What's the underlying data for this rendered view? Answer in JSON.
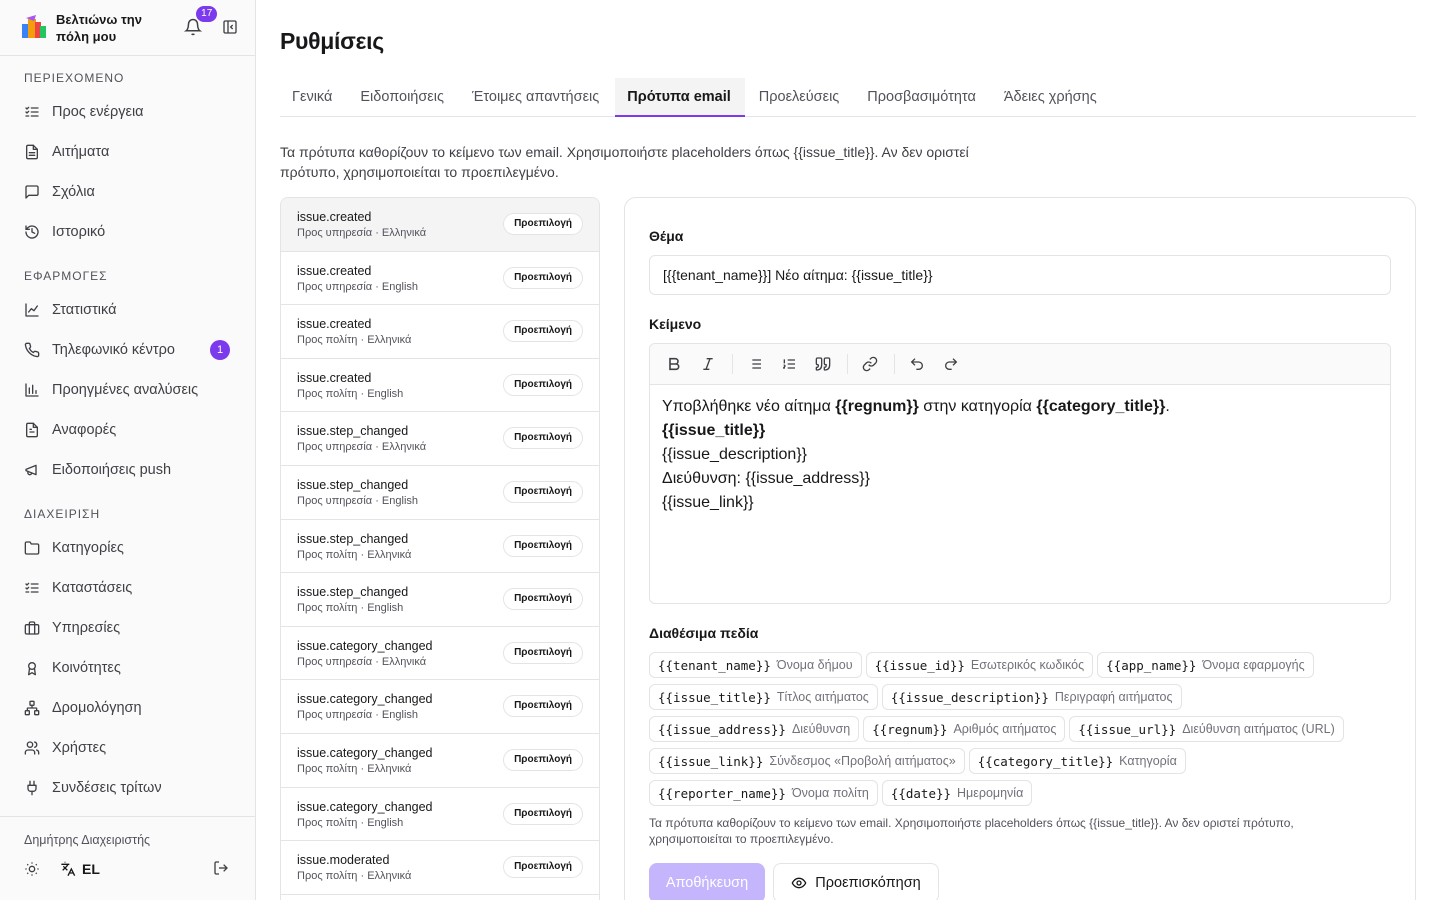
{
  "app": {
    "name": "Βελτιώνω την πόλη μου",
    "notification_count": "17"
  },
  "sidebar": {
    "sections": [
      {
        "title": "ΠΕΡΙΕΧΟΜΕΝΟ",
        "items": [
          {
            "label": "Προς ενέργεια",
            "icon": "list-check-icon"
          },
          {
            "label": "Αιτήματα",
            "icon": "document-icon"
          },
          {
            "label": "Σχόλια",
            "icon": "comment-icon"
          },
          {
            "label": "Ιστορικό",
            "icon": "history-icon"
          }
        ]
      },
      {
        "title": "ΕΦΑΡΜΟΓΕΣ",
        "items": [
          {
            "label": "Στατιστικά",
            "icon": "line-chart-icon"
          },
          {
            "label": "Τηλεφωνικό κέντρο",
            "icon": "phone-icon",
            "badge": "1"
          },
          {
            "label": "Προηγμένες αναλύσεις",
            "icon": "bar-chart-icon"
          },
          {
            "label": "Αναφορές",
            "icon": "report-icon"
          },
          {
            "label": "Ειδοποιήσεις push",
            "icon": "megaphone-icon"
          }
        ]
      },
      {
        "title": "ΔΙΑΧΕΙΡΙΣΗ",
        "items": [
          {
            "label": "Κατηγορίες",
            "icon": "folder-icon"
          },
          {
            "label": "Καταστάσεις",
            "icon": "status-list-icon"
          },
          {
            "label": "Υπηρεσίες",
            "icon": "briefcase-icon"
          },
          {
            "label": "Κοινότητες",
            "icon": "community-icon"
          },
          {
            "label": "Δρομολόγηση",
            "icon": "route-icon"
          },
          {
            "label": "Χρήστες",
            "icon": "users-icon"
          },
          {
            "label": "Συνδέσεις τρίτων",
            "icon": "plug-icon"
          }
        ]
      }
    ],
    "user_name": "Δημήτρης Διαχειριστής",
    "language": "EL"
  },
  "page": {
    "title": "Ρυθμίσεις",
    "tabs": [
      "Γενικά",
      "Ειδοποιήσεις",
      "Έτοιμες απαντήσεις",
      "Πρότυπα email",
      "Προελεύσεις",
      "Προσβασιμότητα",
      "Άδειες χρήσης"
    ],
    "active_tab": "Πρότυπα email",
    "intro": "Τα πρότυπα καθορίζουν το κείμενο των email. Χρησιμοποιήστε placeholders όπως {{issue_title}}. Αν δεν οριστεί πρότυπο, χρησιμοποιείται το προεπιλεγμένο."
  },
  "templates": [
    {
      "key": "issue.created",
      "sub": "Προς υπηρεσία · Ελληνικά",
      "badge": "Προεπιλογή"
    },
    {
      "key": "issue.created",
      "sub": "Προς υπηρεσία · English",
      "badge": "Προεπιλογή"
    },
    {
      "key": "issue.created",
      "sub": "Προς πολίτη · Ελληνικά",
      "badge": "Προεπιλογή"
    },
    {
      "key": "issue.created",
      "sub": "Προς πολίτη · English",
      "badge": "Προεπιλογή"
    },
    {
      "key": "issue.step_changed",
      "sub": "Προς υπηρεσία · Ελληνικά",
      "badge": "Προεπιλογή"
    },
    {
      "key": "issue.step_changed",
      "sub": "Προς υπηρεσία · English",
      "badge": "Προεπιλογή"
    },
    {
      "key": "issue.step_changed",
      "sub": "Προς πολίτη · Ελληνικά",
      "badge": "Προεπιλογή"
    },
    {
      "key": "issue.step_changed",
      "sub": "Προς πολίτη · English",
      "badge": "Προεπιλογή"
    },
    {
      "key": "issue.category_changed",
      "sub": "Προς υπηρεσία · Ελληνικά",
      "badge": "Προεπιλογή"
    },
    {
      "key": "issue.category_changed",
      "sub": "Προς υπηρεσία · English",
      "badge": "Προεπιλογή"
    },
    {
      "key": "issue.category_changed",
      "sub": "Προς πολίτη · Ελληνικά",
      "badge": "Προεπιλογή"
    },
    {
      "key": "issue.category_changed",
      "sub": "Προς πολίτη · English",
      "badge": "Προεπιλογή"
    },
    {
      "key": "issue.moderated",
      "sub": "Προς πολίτη · Ελληνικά",
      "badge": "Προεπιλογή"
    }
  ],
  "editor": {
    "subject_label": "Θέμα",
    "subject_value": "[{{tenant_name}}] Νέο αίτημα: {{issue_title}}",
    "body_label": "Κείμενο",
    "body": {
      "line1_prefix": "Υποβλήθηκε νέο αίτημα ",
      "line1_regnum": "{{regnum}}",
      "line1_middle": " στην κατηγορία ",
      "line1_category": "{{category_title}}",
      "line1_suffix": ".",
      "line2": "{{issue_title}}",
      "line3": "{{issue_description}}",
      "line4": "Διεύθυνση: {{issue_address}}",
      "line5": "{{issue_link}}"
    },
    "fields_label": "Διαθέσιμα πεδία",
    "fields": [
      {
        "code": "{{tenant_name}}",
        "desc": "Όνομα δήμου"
      },
      {
        "code": "{{issue_id}}",
        "desc": "Εσωτερικός κωδικός"
      },
      {
        "code": "{{app_name}}",
        "desc": "Όνομα εφαρμογής"
      },
      {
        "code": "{{issue_title}}",
        "desc": "Τίτλος αιτήματος"
      },
      {
        "code": "{{issue_description}}",
        "desc": "Περιγραφή αιτήματος"
      },
      {
        "code": "{{issue_address}}",
        "desc": "Διεύθυνση"
      },
      {
        "code": "{{regnum}}",
        "desc": "Αριθμός αιτήματος"
      },
      {
        "code": "{{issue_url}}",
        "desc": "Διεύθυνση αιτήματος (URL)"
      },
      {
        "code": "{{issue_link}}",
        "desc": "Σύνδεσμος «Προβολή αιτήματος»"
      },
      {
        "code": "{{category_title}}",
        "desc": "Κατηγορία"
      },
      {
        "code": "{{reporter_name}}",
        "desc": "Όνομα πολίτη"
      },
      {
        "code": "{{date}}",
        "desc": "Ημερομηνία"
      }
    ],
    "hint": "Τα πρότυπα καθορίζουν το κείμενο των email. Χρησιμοποιήστε placeholders όπως {{issue_title}}. Αν δεν οριστεί πρότυπο, χρησιμοποιείται το προεπιλεγμένο.",
    "save_label": "Αποθήκευση",
    "preview_label": "Προεπισκόπηση"
  },
  "colors": {
    "accent": "#7c3aed",
    "accent_light": "#c4b5fd",
    "border": "#e4e4e7"
  }
}
